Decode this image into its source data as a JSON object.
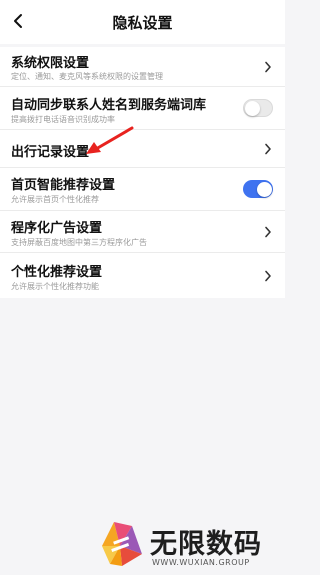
{
  "header": {
    "title": "隐私设置",
    "back_icon": "chevron-left-icon"
  },
  "settings": [
    {
      "label": "系统权限设置",
      "sub": "定位、通知、麦克风等系统权限的设置管理",
      "control": "chevron"
    },
    {
      "label": "自动同步联系人姓名到服务端词库",
      "sub": "提高拨打电话语音识别成功率",
      "control": "toggle",
      "enabled": false
    },
    {
      "label": "出行记录设置",
      "sub": "",
      "control": "chevron"
    },
    {
      "label": "首页智能推荐设置",
      "sub": "允许展示首页个性化推荐",
      "control": "toggle",
      "enabled": true
    },
    {
      "label": "程序化广告设置",
      "sub": "支持屏蔽百度地图中第三方程序化广告",
      "control": "chevron"
    },
    {
      "label": "个性化推荐设置",
      "sub": "允许展示个性化推荐功能",
      "control": "chevron"
    }
  ],
  "watermark": {
    "name": "无限数码",
    "url": "WWW.WUXIAN.GROUP"
  },
  "colors": {
    "toggle_on": "#3f73f0",
    "annotation_arrow": "#e8231f"
  }
}
